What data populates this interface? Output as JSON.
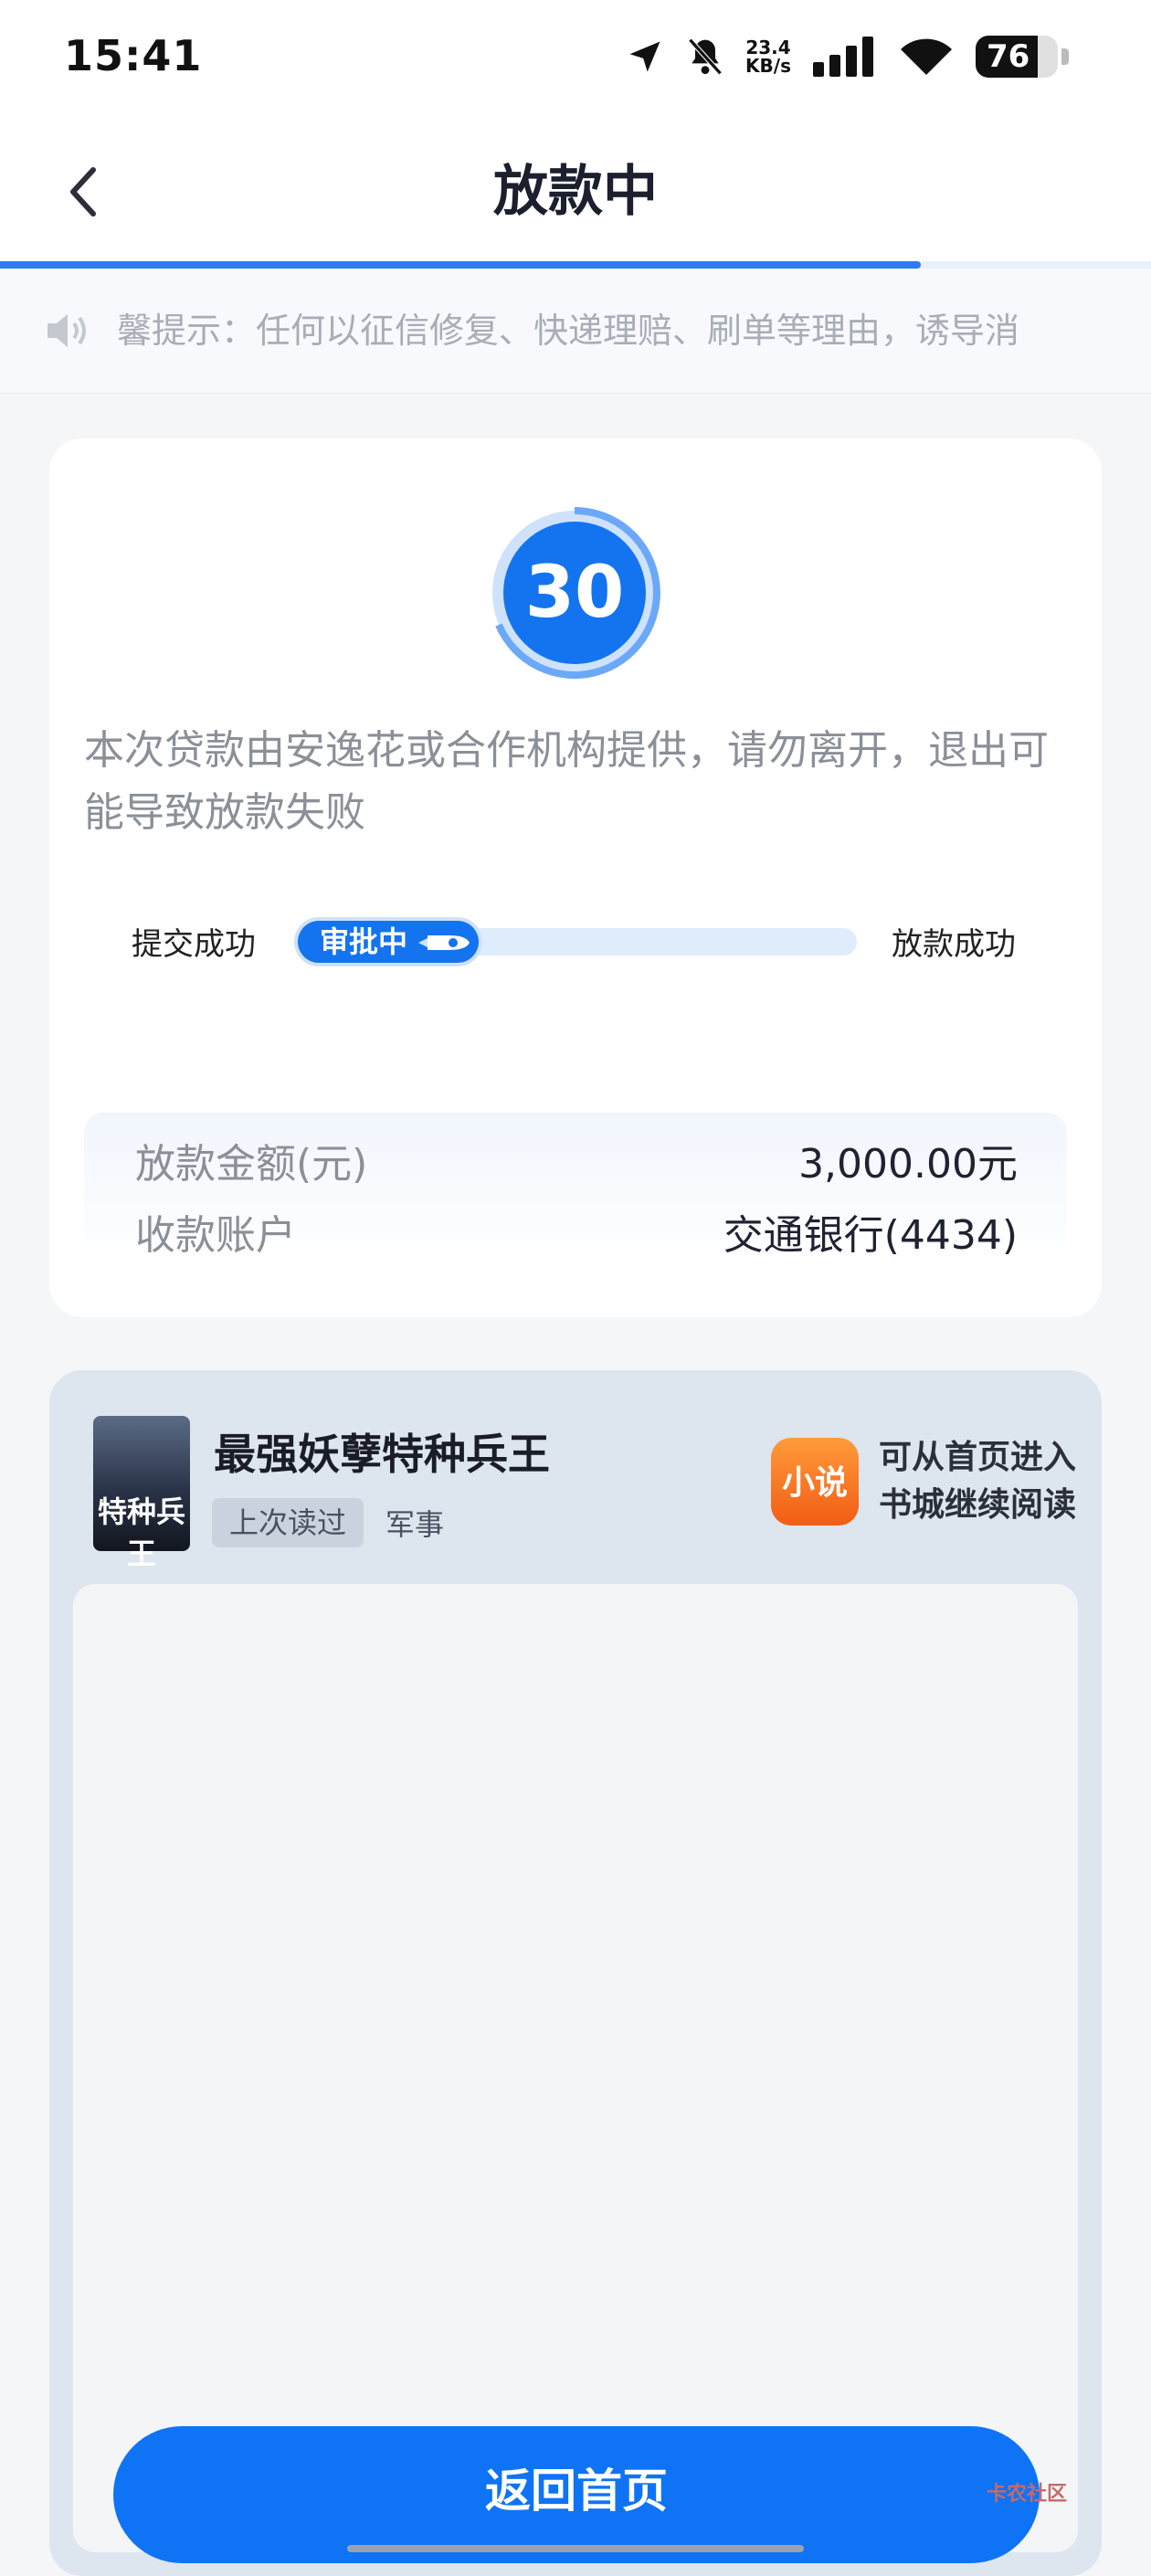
{
  "status_bar": {
    "time": "15:41",
    "net_speed_value": "23.4",
    "net_speed_unit": "KB/s",
    "battery": "76"
  },
  "header": {
    "title": "放款中"
  },
  "notice": {
    "text": "馨提示：任何以征信修复、快递理赔、刷单等理由，诱导消"
  },
  "loan": {
    "countdown": "30",
    "note": "本次贷款由安逸花或合作机构提供，请勿离开，退出可能导致放款失败",
    "steps": {
      "submitted": "提交成功",
      "current": "审批中",
      "disbursed": "放款成功"
    },
    "amount_label": "放款金额(元)",
    "amount_value": "3,000.00元",
    "account_label": "收款账户",
    "account_value": "交通银行(4434)"
  },
  "novel": {
    "cover_text": "特种兵王",
    "title": "最强妖孽特种兵王",
    "tag_last_read": "上次读过",
    "genre": "军事",
    "logo_text": "小说",
    "hint": "可从首页进入书城继续阅读"
  },
  "actions": {
    "home_button": "返回首页"
  },
  "watermark": {
    "text": "卡农社区"
  },
  "colors": {
    "primary": "#0f73f5",
    "accent_orange": "#f25c14"
  }
}
